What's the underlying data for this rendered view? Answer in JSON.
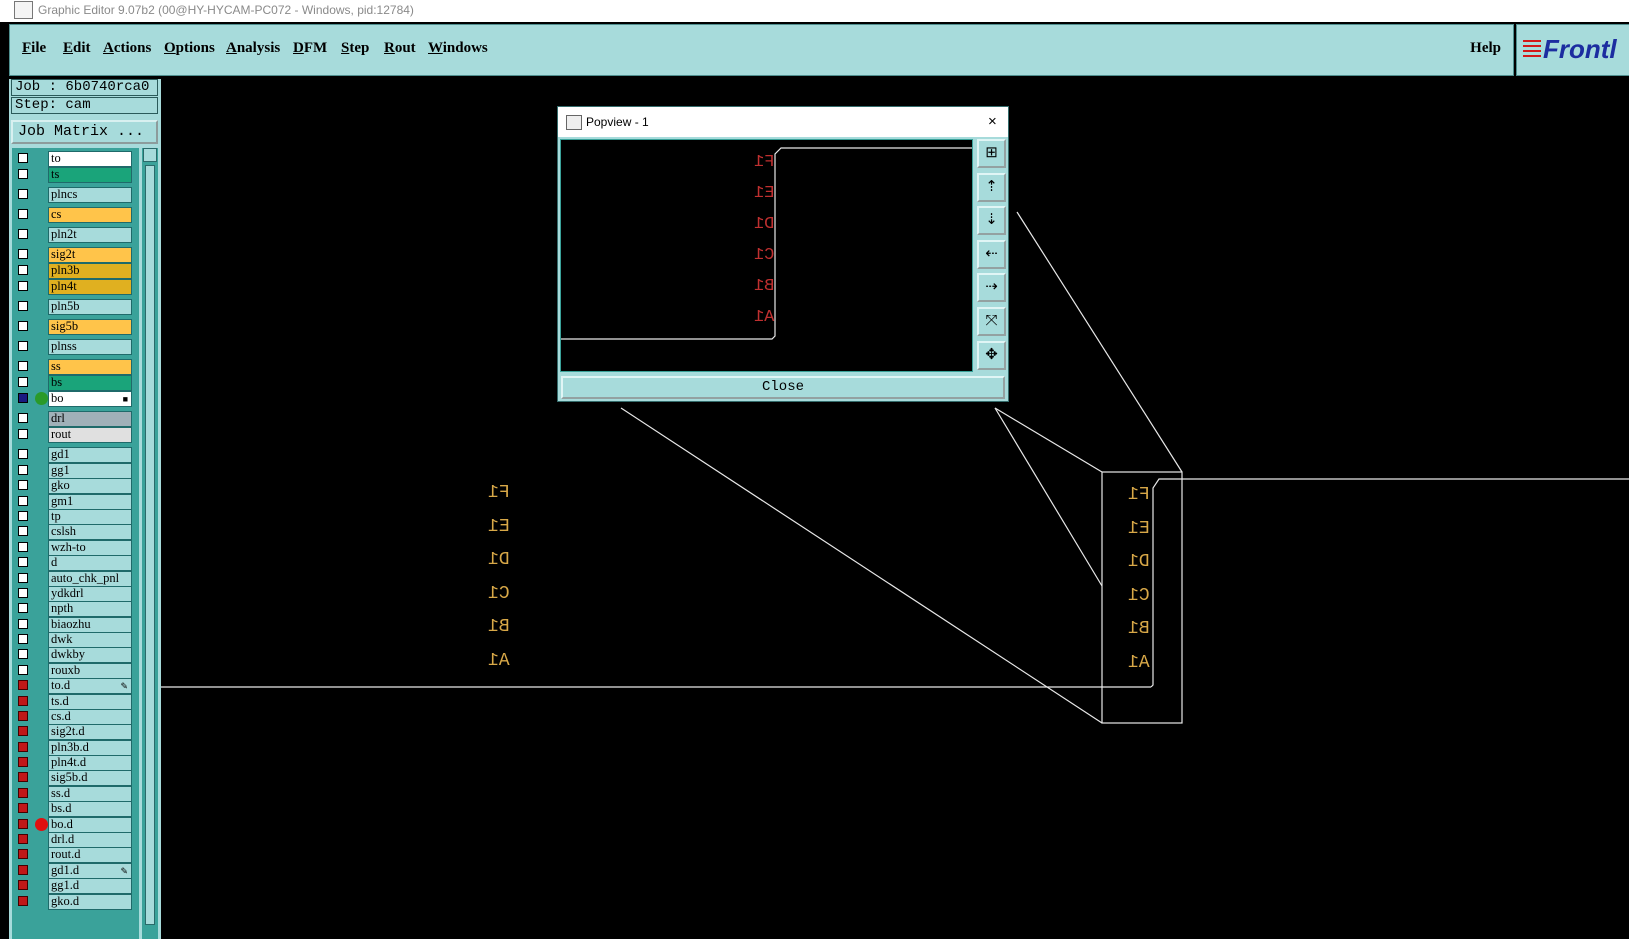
{
  "window": {
    "title": "Graphic Editor 9.07b2 (00@HY-HYCAM-PC072 - Windows, pid:12784)"
  },
  "menu": {
    "items": [
      "File",
      "Edit",
      "Actions",
      "Options",
      "Analysis",
      "DFM",
      "Step",
      "Rout",
      "Windows"
    ],
    "help": "Help"
  },
  "logo": {
    "text": "Frontl"
  },
  "job": {
    "job_line": "Job : 6b0740rca0",
    "step_line": "Step: cam",
    "matrix_button": "Job Matrix ..."
  },
  "layers": [
    {
      "name": "to",
      "color": "#ffffff",
      "cb": "white"
    },
    {
      "name": "ts",
      "color": "#1aa47a",
      "cb": "white"
    },
    {
      "name": "plncs",
      "color": "#a7dbdb",
      "cb": "white"
    },
    {
      "name": "cs",
      "color": "#ffc44a",
      "cb": "white"
    },
    {
      "name": "pln2t",
      "color": "#a7dbdb",
      "cb": "white"
    },
    {
      "name": "sig2t",
      "color": "#ffc44a",
      "cb": "white"
    },
    {
      "name": "pln3b",
      "color": "#e0b020",
      "cb": "white"
    },
    {
      "name": "pln4t",
      "color": "#e0b020",
      "cb": "white"
    },
    {
      "name": "pln5b",
      "color": "#a7dbdb",
      "cb": "white"
    },
    {
      "name": "sig5b",
      "color": "#ffc44a",
      "cb": "white"
    },
    {
      "name": "plnss",
      "color": "#a7dbdb",
      "cb": "white"
    },
    {
      "name": "ss",
      "color": "#ffc44a",
      "cb": "white"
    },
    {
      "name": "bs",
      "color": "#1aa47a",
      "cb": "white"
    },
    {
      "name": "bo",
      "color": "#ffffff",
      "cb": "navy",
      "dot": "#2a9a2a"
    },
    {
      "name": "drl",
      "color": "#a0b0b8",
      "cb": "white"
    },
    {
      "name": "rout",
      "color": "#e0e0e0",
      "cb": "white"
    },
    {
      "name": "gd1",
      "color": "#a7dbdb",
      "cb": "white"
    },
    {
      "name": "gg1",
      "color": "#a7dbdb",
      "cb": "white"
    },
    {
      "name": "gko",
      "color": "#a7dbdb",
      "cb": "white"
    },
    {
      "name": "gm1",
      "color": "#a7dbdb",
      "cb": "white"
    },
    {
      "name": "tp",
      "color": "#a7dbdb",
      "cb": "white"
    },
    {
      "name": "cslsh",
      "color": "#a7dbdb",
      "cb": "white"
    },
    {
      "name": "wzh-to",
      "color": "#a7dbdb",
      "cb": "white"
    },
    {
      "name": "d",
      "color": "#a7dbdb",
      "cb": "white"
    },
    {
      "name": "auto_chk_pnl",
      "color": "#a7dbdb",
      "cb": "white"
    },
    {
      "name": "ydkdrl",
      "color": "#a7dbdb",
      "cb": "white"
    },
    {
      "name": "npth",
      "color": "#a7dbdb",
      "cb": "white"
    },
    {
      "name": "biaozhu",
      "color": "#a7dbdb",
      "cb": "white"
    },
    {
      "name": "dwk",
      "color": "#a7dbdb",
      "cb": "white"
    },
    {
      "name": "dwkby",
      "color": "#a7dbdb",
      "cb": "white"
    },
    {
      "name": "rouxb",
      "color": "#a7dbdb",
      "cb": "white"
    },
    {
      "name": "to.d",
      "color": "#a7dbdb",
      "cb": "red"
    },
    {
      "name": "ts.d",
      "color": "#a7dbdb",
      "cb": "red"
    },
    {
      "name": "cs.d",
      "color": "#a7dbdb",
      "cb": "red"
    },
    {
      "name": "sig2t.d",
      "color": "#a7dbdb",
      "cb": "red"
    },
    {
      "name": "pln3b.d",
      "color": "#a7dbdb",
      "cb": "red"
    },
    {
      "name": "pln4t.d",
      "color": "#a7dbdb",
      "cb": "red"
    },
    {
      "name": "sig5b.d",
      "color": "#a7dbdb",
      "cb": "red"
    },
    {
      "name": "ss.d",
      "color": "#a7dbdb",
      "cb": "red"
    },
    {
      "name": "bs.d",
      "color": "#a7dbdb",
      "cb": "red"
    },
    {
      "name": "bo.d",
      "color": "#a7dbdb",
      "cb": "red",
      "dot": "#e01010"
    },
    {
      "name": "drl.d",
      "color": "#a7dbdb",
      "cb": "red"
    },
    {
      "name": "rout.d",
      "color": "#a7dbdb",
      "cb": "red"
    },
    {
      "name": "gd1.d",
      "color": "#a7dbdb",
      "cb": "red"
    },
    {
      "name": "gg1.d",
      "color": "#a7dbdb",
      "cb": "red"
    },
    {
      "name": "gko.d",
      "color": "#a7dbdb",
      "cb": "red"
    }
  ],
  "popview": {
    "title": "Popview - 1",
    "close_x": "×",
    "close_button": "Close",
    "tools": [
      "zoom-in-icon",
      "pan-up-icon",
      "pan-down-icon",
      "pan-left-icon",
      "pan-right-icon",
      "fit-icon",
      "center-icon"
    ]
  },
  "pads": [
    "F1",
    "E1",
    "D1",
    "C1",
    "B1",
    "A1"
  ]
}
